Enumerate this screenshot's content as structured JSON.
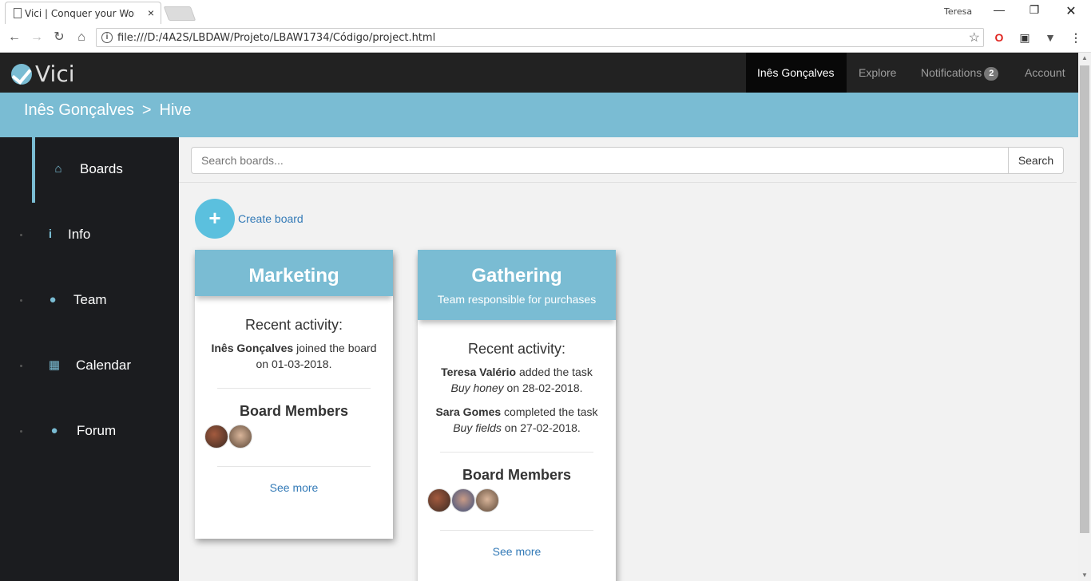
{
  "browser": {
    "tab_title": "Vici | Conquer your Work",
    "tab_close": "×",
    "user": "Teresa",
    "url": "file:///D:/4A2S/LBDAW/Projeto/LBAW1734/Código/project.html",
    "info_glyph": "i"
  },
  "nav": {
    "logo_text": "Vici",
    "user": "Inês Gonçalves",
    "explore": "Explore",
    "notifications": "Notifications",
    "notif_count": "2",
    "account": "Account"
  },
  "breadcrumb": {
    "first": "Inês Gonçalves",
    "separator": ">",
    "second": "Hive"
  },
  "sidebar": {
    "items": [
      {
        "label": "Boards",
        "icon": "home-icon"
      },
      {
        "label": "Info",
        "icon": "info-icon"
      },
      {
        "label": "Team",
        "icon": "user-icon"
      },
      {
        "label": "Calendar",
        "icon": "calendar-icon"
      },
      {
        "label": "Forum",
        "icon": "comments-icon"
      }
    ]
  },
  "search": {
    "placeholder": "Search boards...",
    "button": "Search"
  },
  "create": {
    "glyph": "+",
    "label": "Create board"
  },
  "boards": [
    {
      "title": "Marketing",
      "description": "",
      "recent_heading": "Recent activity:",
      "activities": [
        {
          "who": "Inês Gonçalves",
          "text": " joined the board on 01-03-2018."
        }
      ],
      "members_heading": "Board Members",
      "see_more": "See more"
    },
    {
      "title": "Gathering",
      "description": "Team responsible for purchases",
      "recent_heading": "Recent activity:",
      "activities": [
        {
          "who": "Teresa Valério",
          "text_before": " added the task ",
          "task": "Buy honey",
          "text_after": " on 28-02-2018."
        },
        {
          "who": "Sara Gomes",
          "text_before": " completed the task ",
          "task": "Buy fields",
          "text_after": " on 27-02-2018."
        }
      ],
      "members_heading": "Board Members",
      "see_more": "See more"
    }
  ],
  "colors": {
    "accent": "#7abcd3",
    "navbar": "#222222",
    "sidebar": "#1b1c1f",
    "link": "#337ab7",
    "create_button": "#5bc0de"
  }
}
